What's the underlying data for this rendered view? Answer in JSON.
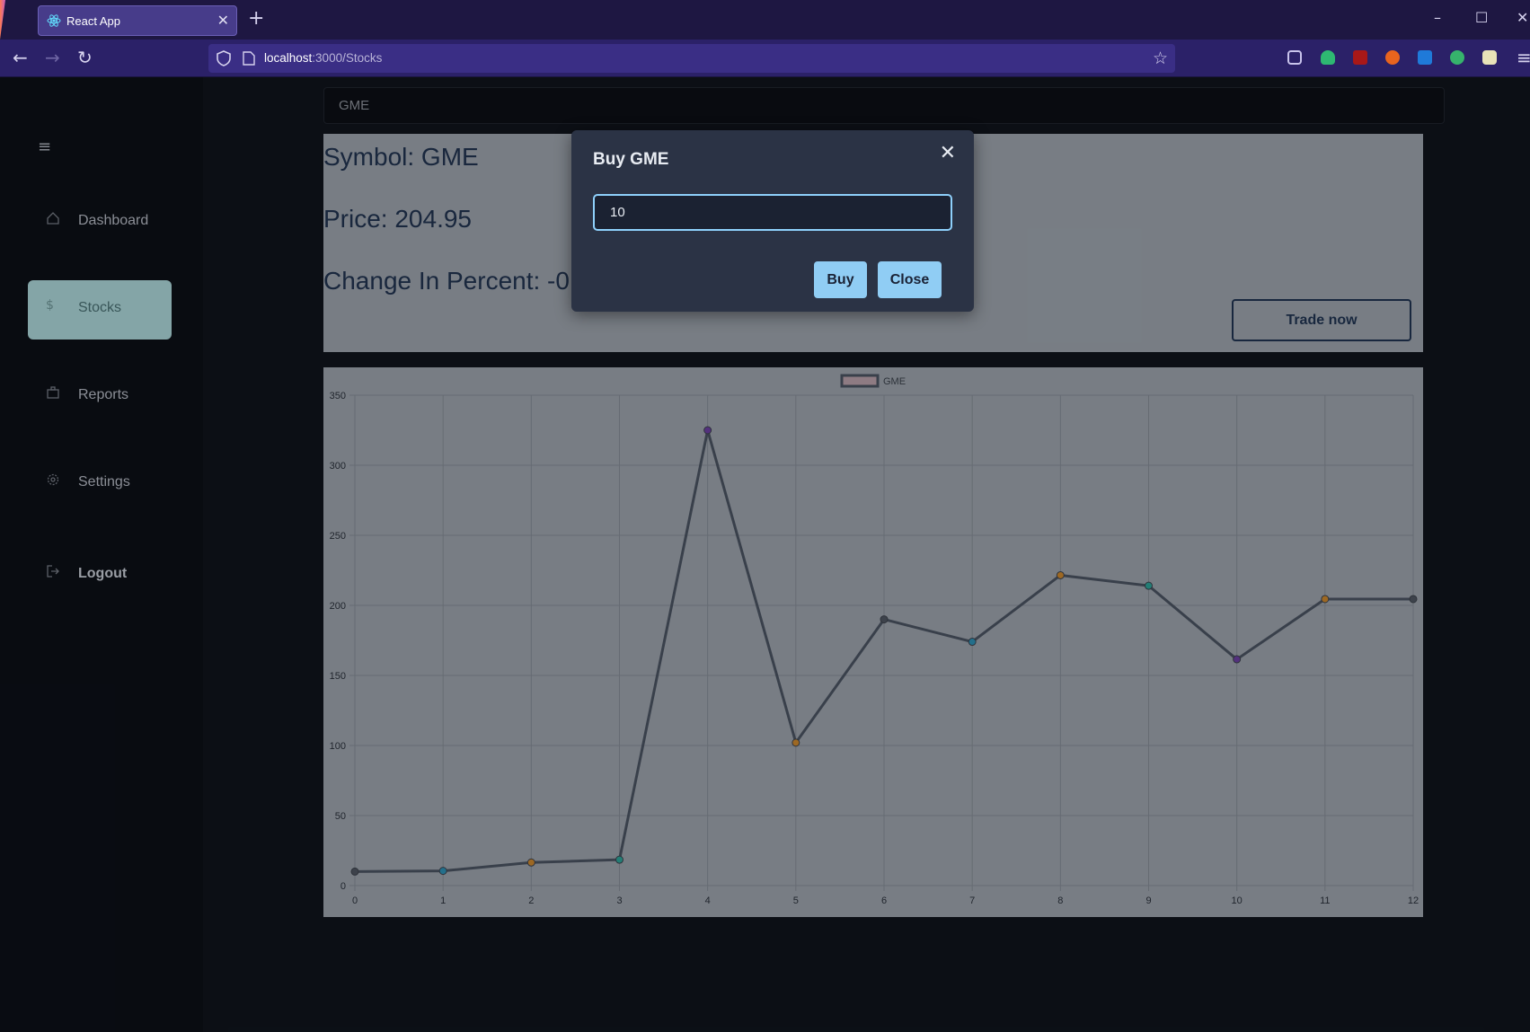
{
  "browser": {
    "tab_title": "React App",
    "url_host": "localhost",
    "url_path": ":3000/Stocks"
  },
  "sidebar": {
    "items": [
      {
        "label": "Dashboard",
        "icon": "home-icon"
      },
      {
        "label": "Stocks",
        "icon": "dollar-icon"
      },
      {
        "label": "Reports",
        "icon": "briefcase-icon"
      },
      {
        "label": "Settings",
        "icon": "gear-icon"
      },
      {
        "label": "Logout",
        "icon": "logout-icon"
      }
    ]
  },
  "search": {
    "value": "GME"
  },
  "stock": {
    "symbol_line": "Symbol: GME",
    "price_line": "Price: 204.95",
    "change_line": "Change In Percent: -0",
    "trade_label": "Trade now"
  },
  "modal": {
    "title": "Buy GME",
    "input_value": "10",
    "buy_label": "Buy",
    "close_label": "Close"
  },
  "chart_data": {
    "type": "line",
    "legend": "GME",
    "x": [
      0,
      1,
      2,
      3,
      4,
      5,
      6,
      7,
      8,
      9,
      10,
      11,
      12
    ],
    "series": [
      {
        "name": "GME",
        "values": [
          10,
          10.5,
          16.5,
          18.5,
          325,
          102,
          190,
          174,
          221.5,
          214,
          161.5,
          204.5,
          204.5
        ]
      }
    ],
    "ylim": [
      0,
      350
    ],
    "yticks": [
      0,
      50,
      100,
      150,
      200,
      250,
      300,
      350
    ],
    "point_colors": [
      "#4f5560",
      "#2e8fb3",
      "#c9862e",
      "#2ea196",
      "#6b3fa0",
      "#c9862e",
      "#4f5560",
      "#2e8fb3",
      "#c9862e",
      "#2ea196",
      "#6b3fa0",
      "#c9862e",
      "#4f5560"
    ],
    "grid": true,
    "legend_position": "top"
  },
  "colors": {
    "accent": "#90cdf4",
    "sidebar_active": "#a9d4d6",
    "card_bg": "#9aa1aa",
    "line": "#4a5260"
  }
}
